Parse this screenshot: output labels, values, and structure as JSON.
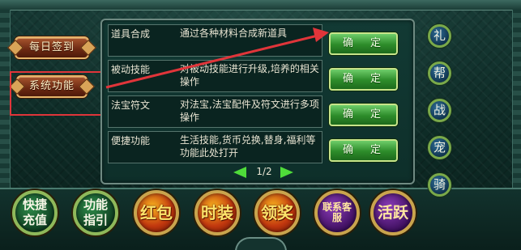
{
  "sidebar": {
    "daily_signin": "每日签到",
    "system_function": "系统功能"
  },
  "features": [
    {
      "name": "道具合成",
      "desc": "通过各种材料合成新道具",
      "button": "确　定"
    },
    {
      "name": "被动技能",
      "desc": "对被动技能进行升级,培养的相关操作",
      "button": "确　定"
    },
    {
      "name": "法宝符文",
      "desc": "对法宝,法宝配件及符文进行多项操作",
      "button": "确　定"
    },
    {
      "name": "便捷功能",
      "desc": "生活技能,货币兑换,替身,福利等功能此处打开",
      "button": "确　定"
    }
  ],
  "pager": {
    "label": "1/2"
  },
  "right_menu": [
    "礼",
    "帮",
    "战",
    "宠",
    "骑"
  ],
  "bottom_menu": {
    "quick_recharge": "快捷充值",
    "function_guide": "功能指引",
    "red_packet": "红包",
    "fashion": "时装",
    "claim_reward": "领奖",
    "customer_service": "联系客服",
    "activity": "活跃"
  },
  "colors": {
    "annotation_red": "#e0353a",
    "confirm_green": "#2d8c2a",
    "side_button_brown": "#6b2812"
  }
}
